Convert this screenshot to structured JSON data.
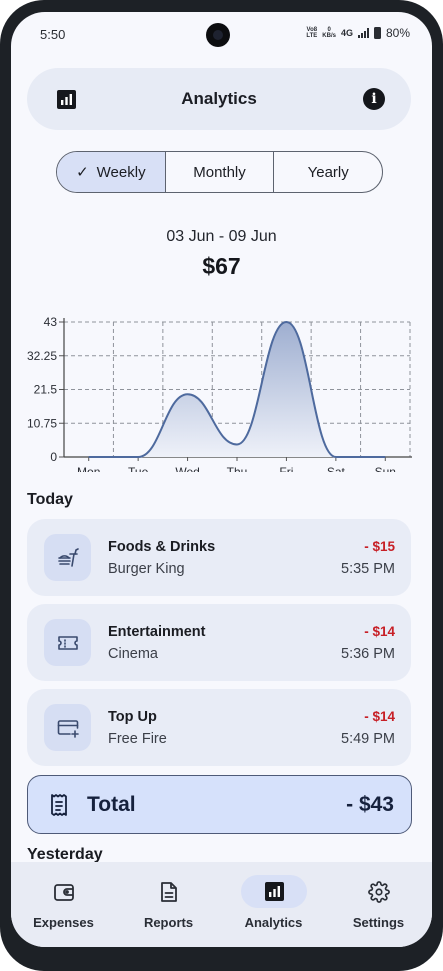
{
  "status": {
    "time": "5:50",
    "volte": "Vo8 LTE",
    "speed": "0 KB/s",
    "network": "4G",
    "battery": "80%"
  },
  "header": {
    "title": "Analytics"
  },
  "tabs": {
    "weekly": "Weekly",
    "monthly": "Monthly",
    "yearly": "Yearly"
  },
  "summary": {
    "range": "03 Jun - 09 Jun",
    "amount": "$67"
  },
  "chart_data": {
    "type": "area",
    "categories": [
      "Mon",
      "Tue",
      "Wed",
      "Thu",
      "Fri",
      "Sat",
      "Sun"
    ],
    "series": [
      {
        "values": [
          0,
          0,
          20,
          4,
          43,
          0,
          0
        ]
      }
    ],
    "yticks": [
      "0",
      "10.75",
      "21.5",
      "32.25",
      "43"
    ],
    "ylim": [
      0,
      43
    ],
    "grid": true,
    "colors": {
      "line": "#4e6a9e",
      "fill_top": "#9eaed0",
      "fill_bottom": "#eef1f9",
      "grid": "#8f939b"
    }
  },
  "today": {
    "heading": "Today",
    "items": [
      {
        "category": "Foods & Drinks",
        "merchant": "Burger King",
        "amount": "- $15",
        "time": "5:35 PM",
        "icon": "fast-food-icon"
      },
      {
        "category": "Entertainment",
        "merchant": "Cinema",
        "amount": "- $14",
        "time": "5:36 PM",
        "icon": "ticket-icon"
      },
      {
        "category": "Top Up",
        "merchant": "Free Fire",
        "amount": "- $14",
        "time": "5:49 PM",
        "icon": "card-add-icon"
      }
    ]
  },
  "total": {
    "label": "Total",
    "value": "- $43"
  },
  "yesterday": {
    "heading": "Yesterday"
  },
  "nav": [
    {
      "label": "Expenses",
      "icon": "wallet-icon"
    },
    {
      "label": "Reports",
      "icon": "document-icon"
    },
    {
      "label": "Analytics",
      "icon": "analytics-icon",
      "active": true
    },
    {
      "label": "Settings",
      "icon": "gear-icon"
    }
  ],
  "colors": {
    "accent": "#d8e0f6",
    "expense": "#c71f26",
    "background": "#f7f8fd",
    "card": "#e8ecf6"
  }
}
